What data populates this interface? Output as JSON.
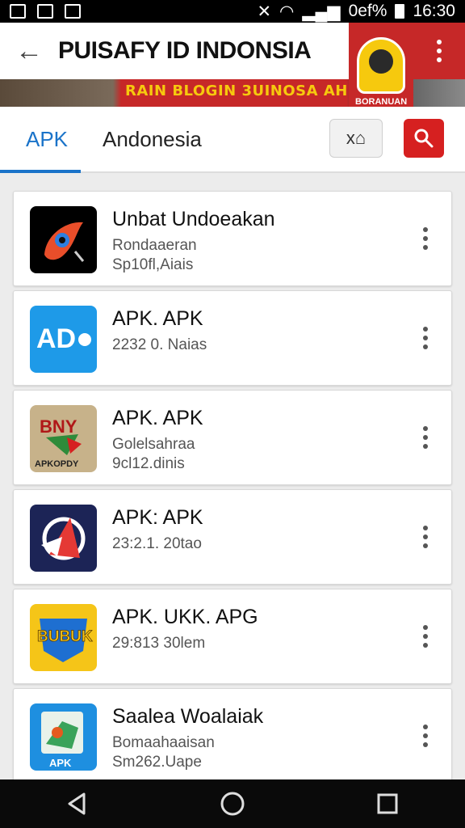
{
  "status_bar": {
    "right_text": "0ef%",
    "time": "16:30"
  },
  "header": {
    "back_glyph": "←",
    "title": "PUISAFY ID INDONSIA",
    "banner_text": "RAIN BLOGIN 3UINOSA AHNAK",
    "ad_caption": "BORANUAN"
  },
  "tabs": [
    {
      "label": "APK",
      "active": true
    },
    {
      "label": "Andonesia",
      "active": false
    }
  ],
  "toolbar": {
    "home_label": "x⌂"
  },
  "apps": [
    {
      "name": "Unbat Undoeakan",
      "line1": "Rondaaeran",
      "line2": "Sp10fl,Aiais",
      "icon": "brush-app-icon"
    },
    {
      "name": "APK. APK",
      "line1": "2232 0. Naias",
      "line2": "",
      "icon": "ad-app-icon"
    },
    {
      "name": "APK. APK",
      "line1": "Golelsahraa",
      "line2": "9cl12.dinis",
      "icon": "apkopdy-app-icon",
      "icon_text_top": "BNY",
      "icon_text_bottom": "APKOPDY"
    },
    {
      "name": "APK: APK",
      "line1": "23:2.1. 20tao",
      "line2": "",
      "icon": "rocket-app-icon"
    },
    {
      "name": "APK. UKK. APG",
      "line1": "29:813 30lem",
      "line2": "",
      "icon": "shield-app-icon",
      "icon_text_top": "BUBUK"
    },
    {
      "name": "Saalea Woalaiak",
      "line1": "Bomaahaaisan",
      "line2": "Sm262.Uape",
      "icon": "map-app-icon",
      "icon_text_bottom": "APK"
    }
  ],
  "colors": {
    "accent": "#1a73c9",
    "search": "#d62020",
    "banner": "#c62828"
  }
}
